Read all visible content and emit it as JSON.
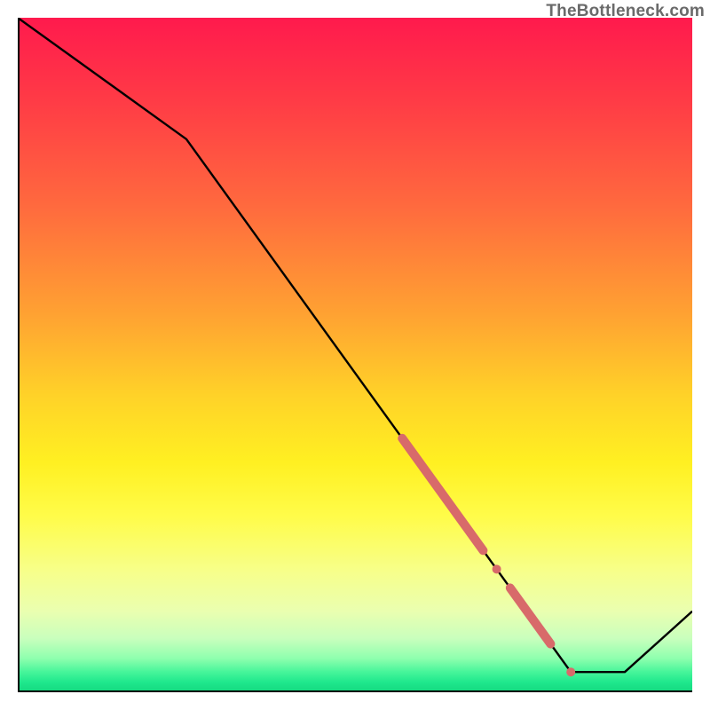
{
  "watermark": "TheBottleneck.com",
  "chart_data": {
    "type": "line",
    "title": "",
    "xlabel": "",
    "ylabel": "",
    "xlim": [
      0,
      100
    ],
    "ylim": [
      0,
      100
    ],
    "grid": false,
    "legend": false,
    "series": [
      {
        "name": "bottleneck-curve",
        "x": [
          0,
          25,
          82,
          90,
          100
        ],
        "y": [
          100,
          82,
          3,
          3,
          12
        ],
        "stroke": "#000000",
        "width": 2.4
      }
    ],
    "markers": [
      {
        "name": "highlight-segment-1",
        "type": "line",
        "on_series": "bottleneck-curve",
        "x_start": 57,
        "x_end": 69,
        "color": "#d86a6a",
        "width": 10
      },
      {
        "name": "highlight-dot-1",
        "type": "point",
        "on_series": "bottleneck-curve",
        "x": 71,
        "color": "#d86a6a",
        "radius": 5
      },
      {
        "name": "highlight-segment-2",
        "type": "line",
        "on_series": "bottleneck-curve",
        "x_start": 73,
        "x_end": 79,
        "color": "#d86a6a",
        "width": 10
      },
      {
        "name": "highlight-dot-2",
        "type": "point",
        "on_series": "bottleneck-curve",
        "x": 82,
        "color": "#d86a6a",
        "radius": 5
      }
    ],
    "background_gradient": {
      "direction": "vertical",
      "stops": [
        {
          "pos": 0.0,
          "color": "#ff1a4d"
        },
        {
          "pos": 0.59,
          "color": "#fff022"
        },
        {
          "pos": 0.97,
          "color": "#46f59a"
        },
        {
          "pos": 1.0,
          "color": "#14d87f"
        }
      ]
    }
  }
}
